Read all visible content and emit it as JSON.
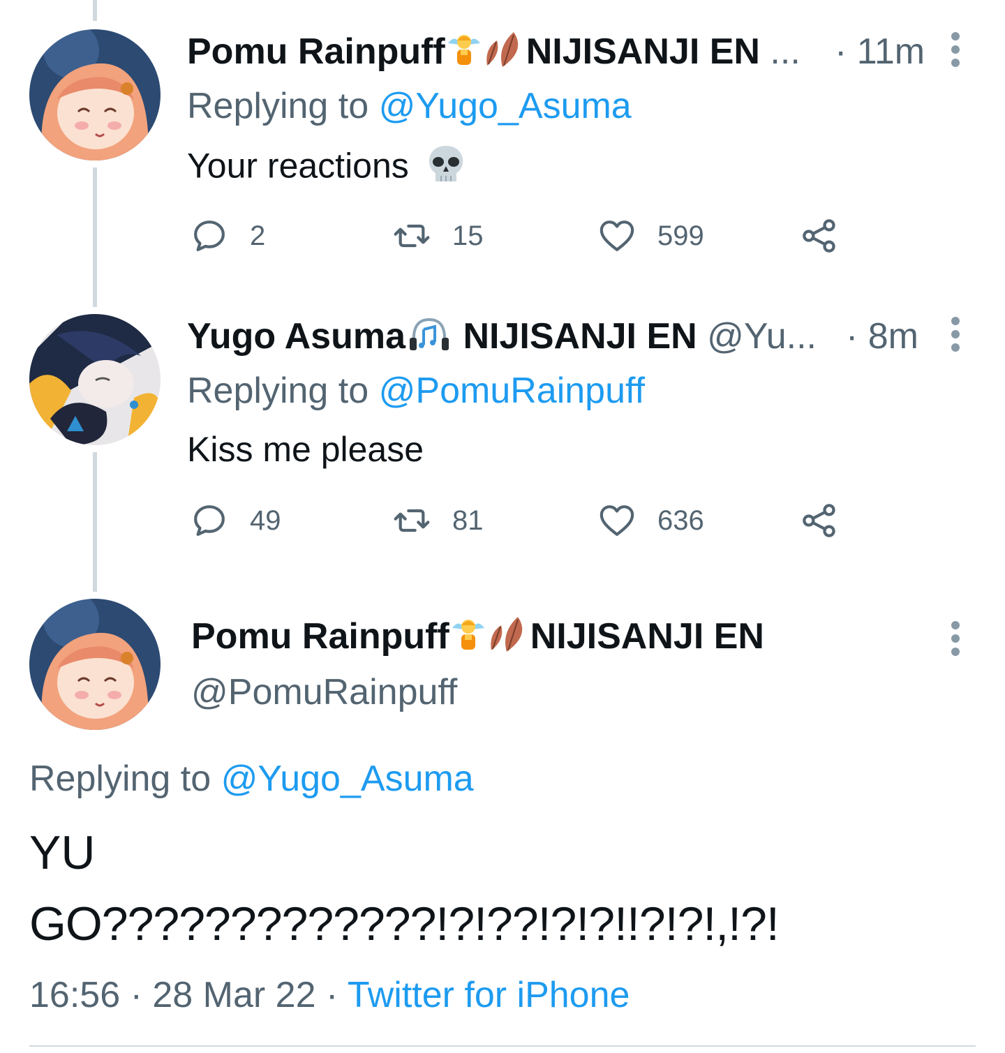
{
  "tweets": [
    {
      "display_name": "Pomu Rainpuff",
      "affiliation": "NIJISANJI EN",
      "handle_truncated": "...",
      "time": "· 11m",
      "replying_label": "Replying to",
      "replying_handle": "@Yugo_Asuma",
      "text": "Your reactions",
      "text_emoji": "skull-emoji",
      "replies": "2",
      "retweets": "15",
      "likes": "599"
    },
    {
      "display_name": "Yugo Asuma",
      "affiliation": "NIJISANJI EN",
      "handle_truncated": "@Yu...",
      "time": "· 8m",
      "replying_label": "Replying to",
      "replying_handle": "@PomuRainpuff",
      "text": "Kiss me please",
      "replies": "49",
      "retweets": "81",
      "likes": "636"
    }
  ],
  "focused": {
    "display_name": "Pomu Rainpuff",
    "affiliation": "NIJISANJI EN",
    "handle": "@PomuRainpuff",
    "replying_label": "Replying to",
    "replying_handle": "@Yugo_Asuma",
    "text_line1": "YU",
    "text_line2": "GO?????????????!?!??!?!?!!?!?!,!?!",
    "time": "16:56",
    "date": "28 Mar 22",
    "sep": "·",
    "source": "Twitter for iPhone"
  },
  "colors": {
    "link": "#1d9bf0",
    "muted": "#536471",
    "line": "#cfd9de"
  },
  "icons": [
    "reply-icon",
    "retweet-icon",
    "like-icon",
    "share-icon",
    "more-icon",
    "fairy-emoji",
    "leaf-emoji",
    "headphones-emoji"
  ]
}
